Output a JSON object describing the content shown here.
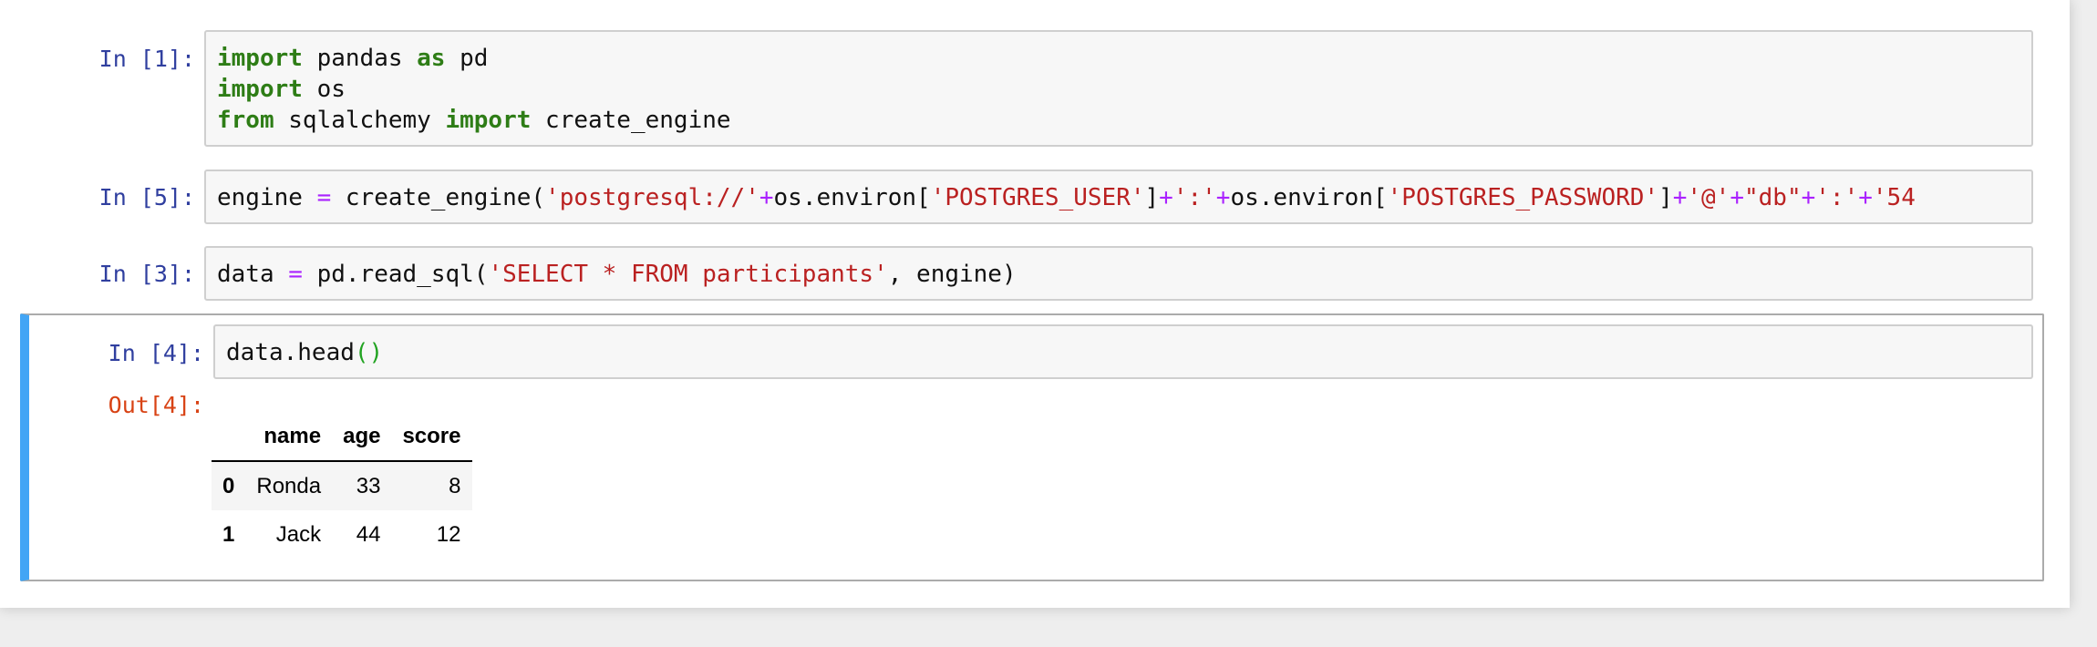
{
  "cells": [
    {
      "prompt": "In [1]:",
      "lines": [
        [
          {
            "t": "import",
            "c": "kw"
          },
          {
            "t": " pandas "
          },
          {
            "t": "as",
            "c": "kw"
          },
          {
            "t": " pd"
          }
        ],
        [
          {
            "t": "import",
            "c": "kw"
          },
          {
            "t": " os"
          }
        ],
        [
          {
            "t": "from",
            "c": "kw"
          },
          {
            "t": " sqlalchemy "
          },
          {
            "t": "import",
            "c": "kw"
          },
          {
            "t": " create_engine"
          }
        ]
      ]
    },
    {
      "prompt": "In [5]:",
      "lines": [
        [
          {
            "t": "engine "
          },
          {
            "t": "=",
            "c": "op"
          },
          {
            "t": " create_engine("
          },
          {
            "t": "'postgresql://'",
            "c": "str"
          },
          {
            "t": "+",
            "c": "op"
          },
          {
            "t": "os.environ["
          },
          {
            "t": "'POSTGRES_USER'",
            "c": "str"
          },
          {
            "t": "]"
          },
          {
            "t": "+",
            "c": "op"
          },
          {
            "t": "':'",
            "c": "str"
          },
          {
            "t": "+",
            "c": "op"
          },
          {
            "t": "os.environ["
          },
          {
            "t": "'POSTGRES_PASSWORD'",
            "c": "str"
          },
          {
            "t": "]"
          },
          {
            "t": "+",
            "c": "op"
          },
          {
            "t": "'@'",
            "c": "str"
          },
          {
            "t": "+",
            "c": "op"
          },
          {
            "t": "\"db\"",
            "c": "str"
          },
          {
            "t": "+",
            "c": "op"
          },
          {
            "t": "':'",
            "c": "str"
          },
          {
            "t": "+",
            "c": "op"
          },
          {
            "t": "'54",
            "c": "str"
          }
        ]
      ]
    },
    {
      "prompt": "In [3]:",
      "lines": [
        [
          {
            "t": "data "
          },
          {
            "t": "=",
            "c": "op"
          },
          {
            "t": " pd.read_sql("
          },
          {
            "t": "'SELECT * FROM participants'",
            "c": "str"
          },
          {
            "t": ", engine)"
          }
        ]
      ]
    },
    {
      "prompt": "In [4]:",
      "lines": [
        [
          {
            "t": "data.head"
          },
          {
            "t": "()",
            "c": "par"
          }
        ]
      ]
    }
  ],
  "output": {
    "prompt": "Out[4]:",
    "table": {
      "columns": [
        "",
        "name",
        "age",
        "score"
      ],
      "rows": [
        {
          "index": "0",
          "cells": [
            "Ronda",
            "33",
            "8"
          ]
        },
        {
          "index": "1",
          "cells": [
            "Jack",
            "44",
            "12"
          ]
        }
      ]
    }
  }
}
